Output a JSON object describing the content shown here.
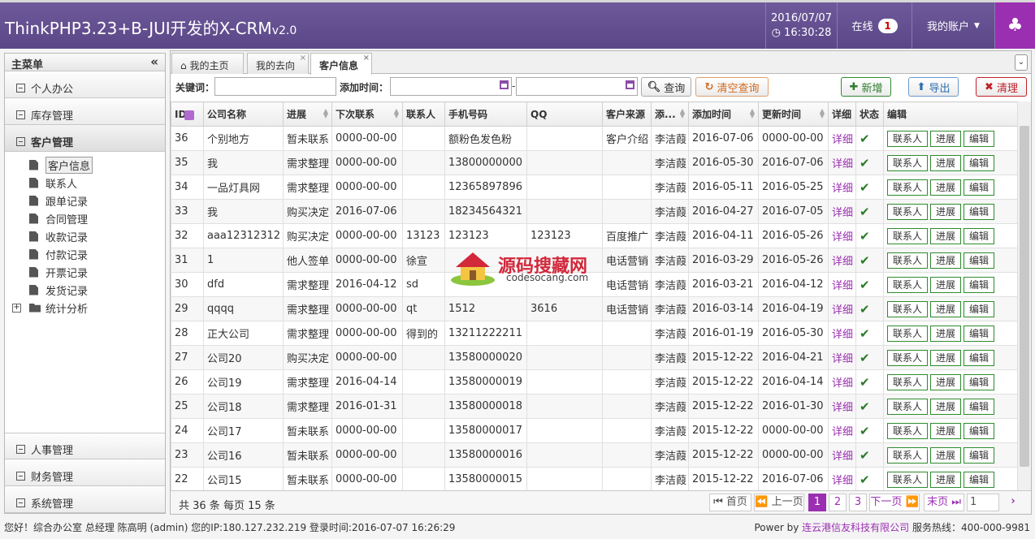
{
  "header": {
    "title": "ThinkPHP3.23+B-JUI开发的X-CRM",
    "version": "v2.0",
    "date": "2016/07/07",
    "time": "16:30:28",
    "online_label": "在线",
    "online_count": "1",
    "account_label": "我的账户"
  },
  "sidebar": {
    "title": "主菜单",
    "sections": [
      "个人办公",
      "库存管理",
      "客户管理"
    ],
    "tree_items": [
      "客户信息",
      "联系人",
      "跟单记录",
      "合同管理",
      "收款记录",
      "付款记录",
      "开票记录",
      "发货记录",
      "统计分析"
    ],
    "bottom_sections": [
      "人事管理",
      "财务管理",
      "系统管理"
    ]
  },
  "tabs": [
    "我的主页",
    "我的去向",
    "客户信息"
  ],
  "search": {
    "keyword_label": "关键词：",
    "addtime_label": "添加时间：",
    "query_button": "查询",
    "clear_button": "清空查询",
    "new_button": "新增",
    "export_button": "导出",
    "clean_button": "清理"
  },
  "columns": [
    "ID",
    "公司名称",
    "进展",
    "下次联系",
    "联系人",
    "手机号码",
    "QQ",
    "客户来源",
    "添...",
    "添加时间",
    "更新时间",
    "详细",
    "状态",
    "编辑"
  ],
  "rows": [
    [
      "36",
      "个别地方",
      "暂未联系",
      "0000-00-00",
      "",
      "额粉色发色粉",
      "",
      "客户介绍",
      "李洁葭",
      "2016-07-06",
      "0000-00-00"
    ],
    [
      "35",
      "我",
      "需求整理",
      "0000-00-00",
      "",
      "13800000000",
      "",
      "",
      "李洁葭",
      "2016-05-30",
      "2016-07-06"
    ],
    [
      "34",
      "一品灯具网",
      "需求整理",
      "0000-00-00",
      "",
      "12365897896",
      "",
      "",
      "李洁葭",
      "2016-05-11",
      "2016-05-25"
    ],
    [
      "33",
      "我",
      "购买决定",
      "2016-07-06",
      "",
      "18234564321",
      "",
      "",
      "李洁葭",
      "2016-04-27",
      "2016-07-05"
    ],
    [
      "32",
      "aaa12312312",
      "购买决定",
      "0000-00-00",
      "13123",
      "123123",
      "123123",
      "百度推广",
      "李洁葭",
      "2016-04-11",
      "2016-05-26"
    ],
    [
      "31",
      "1",
      "他人签单",
      "0000-00-00",
      "徐宣",
      "",
      "",
      "电话营销",
      "李洁葭",
      "2016-03-29",
      "2016-05-26"
    ],
    [
      "30",
      "dfd",
      "需求整理",
      "2016-04-12",
      "sd",
      "",
      "",
      "电话营销",
      "李洁葭",
      "2016-03-21",
      "2016-04-12"
    ],
    [
      "29",
      "qqqq",
      "需求整理",
      "0000-00-00",
      "qt",
      "1512",
      "3616",
      "电话营销",
      "李洁葭",
      "2016-03-14",
      "2016-04-19"
    ],
    [
      "28",
      "正大公司",
      "需求整理",
      "0000-00-00",
      "得到的",
      "13211222211",
      "",
      "",
      "李洁葭",
      "2016-01-19",
      "2016-05-30"
    ],
    [
      "27",
      "公司20",
      "购买决定",
      "0000-00-00",
      "",
      "13580000020",
      "",
      "",
      "李洁葭",
      "2015-12-22",
      "2016-04-21"
    ],
    [
      "26",
      "公司19",
      "需求整理",
      "2016-04-14",
      "",
      "13580000019",
      "",
      "",
      "李洁葭",
      "2015-12-22",
      "2016-04-14"
    ],
    [
      "25",
      "公司18",
      "需求整理",
      "2016-01-31",
      "",
      "13580000018",
      "",
      "",
      "李洁葭",
      "2015-12-22",
      "2016-01-30"
    ],
    [
      "24",
      "公司17",
      "暂未联系",
      "0000-00-00",
      "",
      "13580000017",
      "",
      "",
      "李洁葭",
      "2015-12-22",
      "0000-00-00"
    ],
    [
      "23",
      "公司16",
      "暂未联系",
      "0000-00-00",
      "",
      "13580000016",
      "",
      "",
      "李洁葭",
      "2015-12-22",
      "0000-00-00"
    ],
    [
      "22",
      "公司15",
      "暂未联系",
      "0000-00-00",
      "",
      "13580000015",
      "",
      "",
      "李洁葭",
      "2015-12-22",
      "2016-07-06"
    ]
  ],
  "row_actions": {
    "detail": "详细",
    "contact": "联系人",
    "progress": "进展",
    "edit": "编辑"
  },
  "pager": {
    "info": "共 36 条 每页 15 条",
    "first": "首页",
    "prev": "上一页",
    "pages": [
      "1",
      "2",
      "3"
    ],
    "next": "下一页",
    "last": "末页",
    "page_input": "1"
  },
  "footer": {
    "left": "您好！综合办公室 总经理 陈高明 (admin) 您的IP:180.127.232.219 登录时间:2016-07-07 16:26:29",
    "powered": "Power by",
    "company": "连云港信友科技有限公司",
    "hotline": "服务热线：400-000-9981"
  },
  "watermark": {
    "text": "源码搜藏网",
    "url": "codesocang.com"
  },
  "colors": {
    "header": "#5b4788",
    "accent": "#9b2fb1",
    "green": "#2e8b2e",
    "red": "#d1283a"
  },
  "icons": [
    "home-icon",
    "search-icon",
    "refresh-icon",
    "plus-icon",
    "upload-icon",
    "times-icon",
    "check-icon",
    "tree-icon",
    "clock-icon"
  ]
}
